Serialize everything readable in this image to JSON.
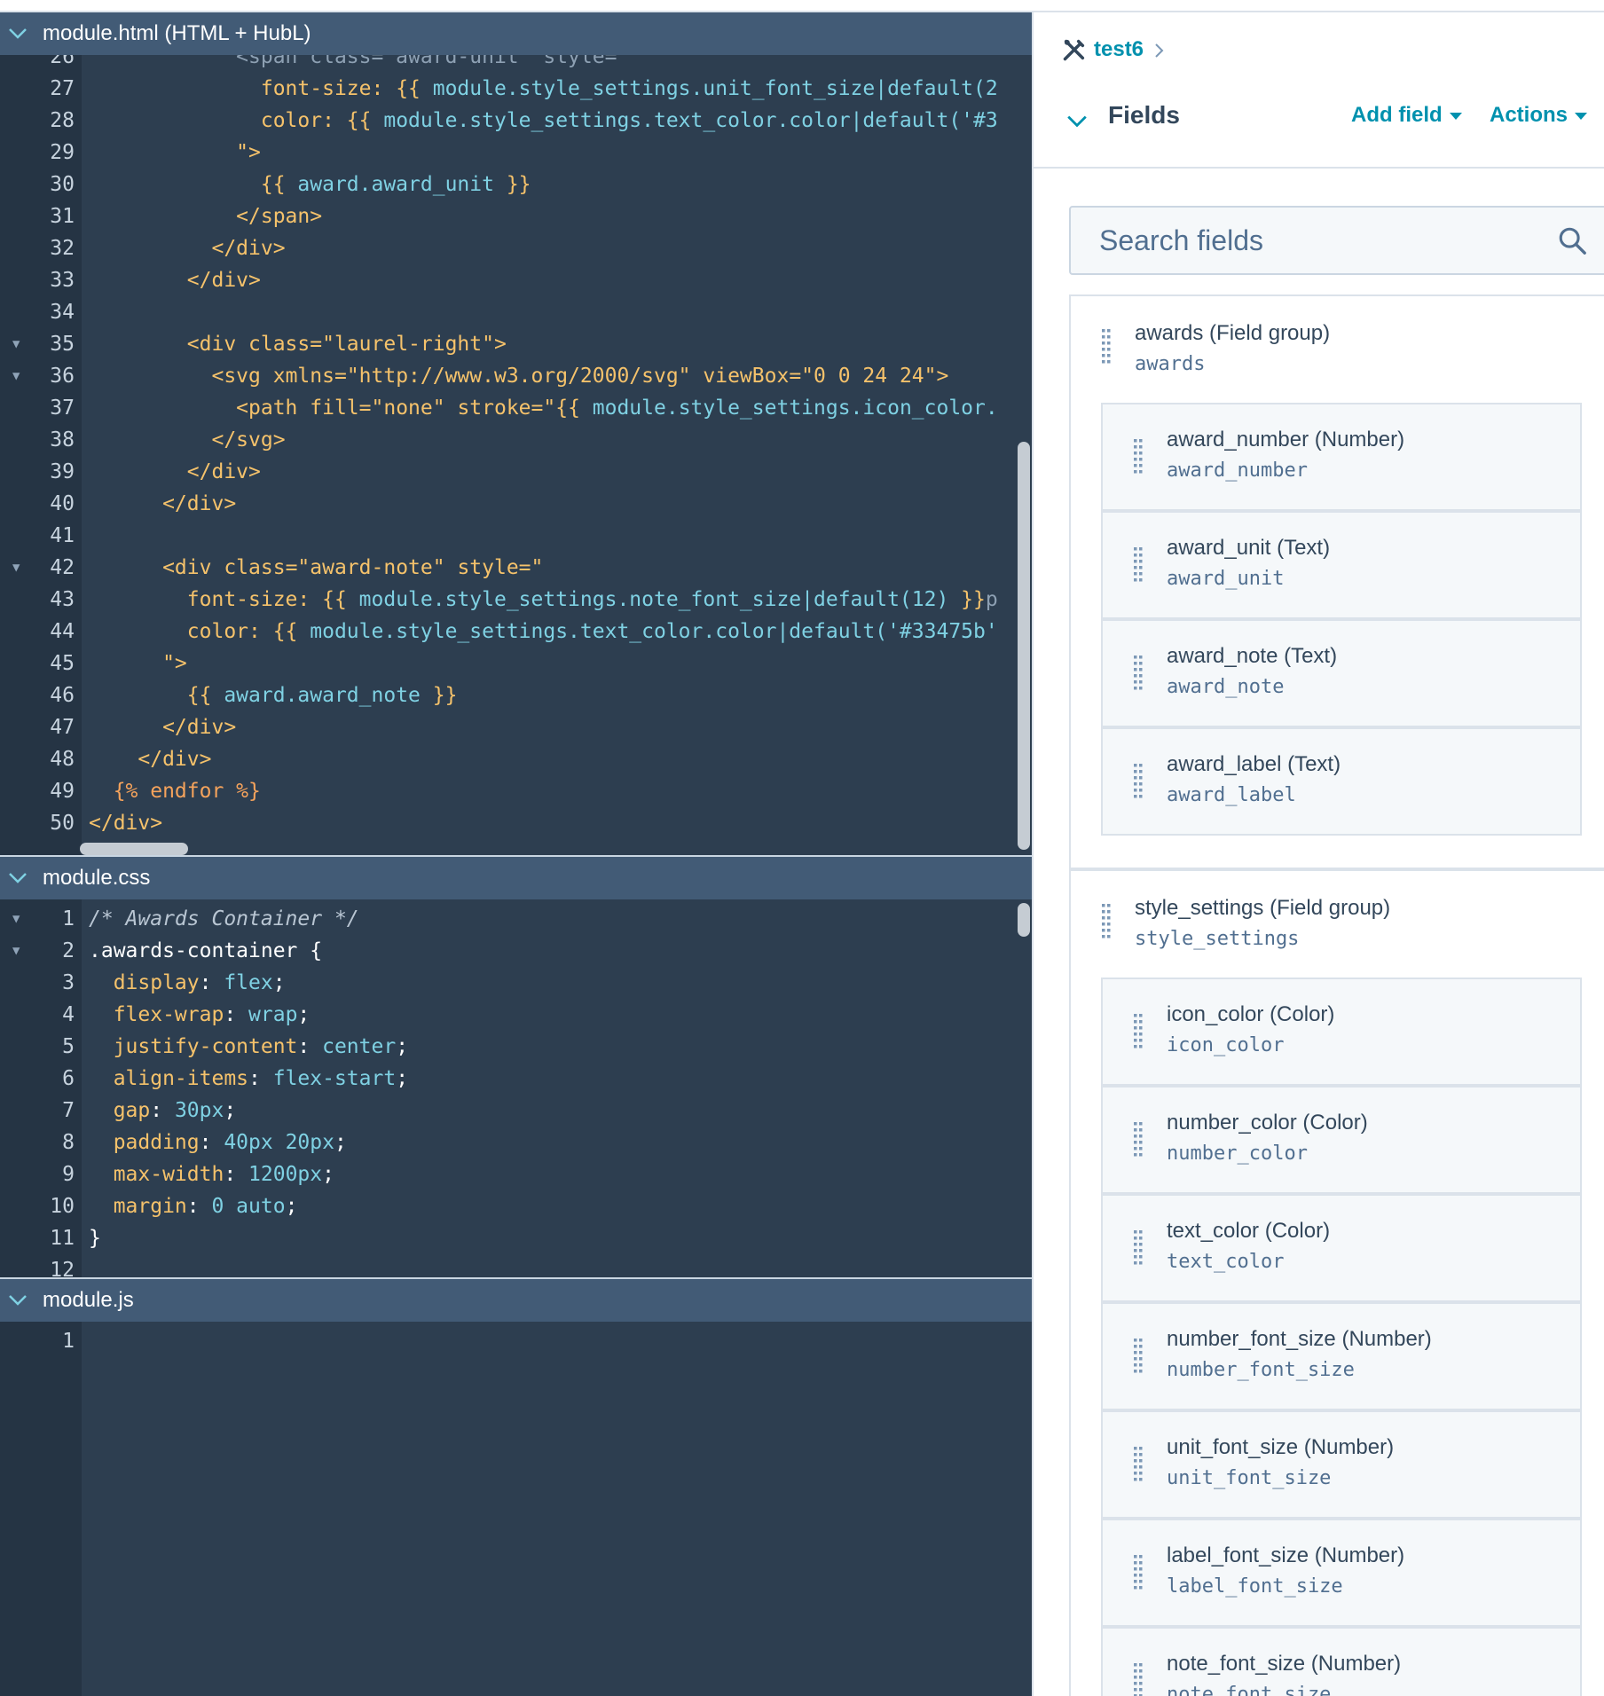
{
  "editor": {
    "html_pane": {
      "title": "module.html (HTML + HubL)",
      "lines": [
        {
          "n": "26",
          "fold": "",
          "tokens": [
            [
              "t-dim",
              "            <span class=\"award-unit\" style=\""
            ]
          ]
        },
        {
          "n": "27",
          "fold": "",
          "tokens": [
            [
              "t-prop",
              "              font-size: "
            ],
            [
              "t-brace",
              "{{ "
            ],
            [
              "t-hubl",
              "module.style_settings.unit_font_size|default(2"
            ]
          ]
        },
        {
          "n": "28",
          "fold": "",
          "tokens": [
            [
              "t-prop",
              "              color: "
            ],
            [
              "t-brace",
              "{{ "
            ],
            [
              "t-hubl",
              "module.style_settings.text_color.color|default('#3"
            ]
          ]
        },
        {
          "n": "29",
          "fold": "",
          "tokens": [
            [
              "t-str",
              "            \">"
            ]
          ]
        },
        {
          "n": "30",
          "fold": "",
          "tokens": [
            [
              "t-brace",
              "              {{ "
            ],
            [
              "t-hubl",
              "award.award_unit "
            ],
            [
              "t-brace",
              "}}"
            ]
          ]
        },
        {
          "n": "31",
          "fold": "",
          "tokens": [
            [
              "t-tag",
              "            </span>"
            ]
          ]
        },
        {
          "n": "32",
          "fold": "",
          "tokens": [
            [
              "t-tag",
              "          </div>"
            ]
          ]
        },
        {
          "n": "33",
          "fold": "",
          "tokens": [
            [
              "t-tag",
              "        </div>"
            ]
          ]
        },
        {
          "n": "34",
          "fold": "",
          "tokens": [
            [
              "t-plain",
              ""
            ]
          ]
        },
        {
          "n": "35",
          "fold": "▼",
          "tokens": [
            [
              "t-tag",
              "        <div "
            ],
            [
              "t-attr",
              "class="
            ],
            [
              "t-str",
              "\"laurel-right\""
            ],
            [
              "t-tag",
              ">"
            ]
          ]
        },
        {
          "n": "36",
          "fold": "▼",
          "tokens": [
            [
              "t-tag",
              "          <svg "
            ],
            [
              "t-attr",
              "xmlns="
            ],
            [
              "t-str",
              "\"http://www.w3.org/2000/svg\" "
            ],
            [
              "t-attr",
              "viewBox="
            ],
            [
              "t-str",
              "\"0 0 24 24\""
            ],
            [
              "t-tag",
              ">"
            ]
          ]
        },
        {
          "n": "37",
          "fold": "",
          "tokens": [
            [
              "t-tag",
              "            <path "
            ],
            [
              "t-attr",
              "fill="
            ],
            [
              "t-str",
              "\"none\" "
            ],
            [
              "t-attr",
              "stroke="
            ],
            [
              "t-str",
              "\"{{ "
            ],
            [
              "t-hubl",
              "module.style_settings.icon_color."
            ]
          ]
        },
        {
          "n": "38",
          "fold": "",
          "tokens": [
            [
              "t-tag",
              "          </svg>"
            ]
          ]
        },
        {
          "n": "39",
          "fold": "",
          "tokens": [
            [
              "t-tag",
              "        </div>"
            ]
          ]
        },
        {
          "n": "40",
          "fold": "",
          "tokens": [
            [
              "t-tag",
              "      </div>"
            ]
          ]
        },
        {
          "n": "41",
          "fold": "",
          "tokens": [
            [
              "t-plain",
              ""
            ]
          ]
        },
        {
          "n": "42",
          "fold": "▼",
          "tokens": [
            [
              "t-tag",
              "      <div "
            ],
            [
              "t-attr",
              "class="
            ],
            [
              "t-str",
              "\"award-note\" "
            ],
            [
              "t-attr",
              "style="
            ],
            [
              "t-str",
              "\""
            ]
          ]
        },
        {
          "n": "43",
          "fold": "",
          "tokens": [
            [
              "t-prop",
              "        font-size: "
            ],
            [
              "t-brace",
              "{{ "
            ],
            [
              "t-hubl",
              "module.style_settings.note_font_size|default(12) "
            ],
            [
              "t-brace",
              "}}"
            ],
            [
              "t-dim",
              "p"
            ]
          ]
        },
        {
          "n": "44",
          "fold": "",
          "tokens": [
            [
              "t-prop",
              "        color: "
            ],
            [
              "t-brace",
              "{{ "
            ],
            [
              "t-hubl",
              "module.style_settings.text_color.color|default('#33475b'"
            ]
          ]
        },
        {
          "n": "45",
          "fold": "",
          "tokens": [
            [
              "t-str",
              "      \">"
            ]
          ]
        },
        {
          "n": "46",
          "fold": "",
          "tokens": [
            [
              "t-brace",
              "        {{ "
            ],
            [
              "t-hubl",
              "award.award_note "
            ],
            [
              "t-brace",
              "}}"
            ]
          ]
        },
        {
          "n": "47",
          "fold": "",
          "tokens": [
            [
              "t-tag",
              "      </div>"
            ]
          ]
        },
        {
          "n": "48",
          "fold": "",
          "tokens": [
            [
              "t-tag",
              "    </div>"
            ]
          ]
        },
        {
          "n": "49",
          "fold": "",
          "tokens": [
            [
              "t-kw",
              "  {% endfor %}"
            ]
          ]
        },
        {
          "n": "50",
          "fold": "",
          "tokens": [
            [
              "t-tag",
              "</div>"
            ]
          ]
        }
      ]
    },
    "css_pane": {
      "title": "module.css",
      "lines": [
        {
          "n": "1",
          "fold": "▼",
          "tokens": [
            [
              "t-cmt",
              "/* Awards Container */"
            ]
          ]
        },
        {
          "n": "2",
          "fold": "▼",
          "tokens": [
            [
              "t-sel",
              ".awards-container {"
            ]
          ]
        },
        {
          "n": "3",
          "fold": "",
          "tokens": [
            [
              "t-prop",
              "  display"
            ],
            [
              "t-plain",
              ": "
            ],
            [
              "t-val",
              "flex"
            ],
            [
              "t-plain",
              ";"
            ]
          ]
        },
        {
          "n": "4",
          "fold": "",
          "tokens": [
            [
              "t-prop",
              "  flex-wrap"
            ],
            [
              "t-plain",
              ": "
            ],
            [
              "t-val",
              "wrap"
            ],
            [
              "t-plain",
              ";"
            ]
          ]
        },
        {
          "n": "5",
          "fold": "",
          "tokens": [
            [
              "t-prop",
              "  justify-content"
            ],
            [
              "t-plain",
              ": "
            ],
            [
              "t-val",
              "center"
            ],
            [
              "t-plain",
              ";"
            ]
          ]
        },
        {
          "n": "6",
          "fold": "",
          "tokens": [
            [
              "t-prop",
              "  align-items"
            ],
            [
              "t-plain",
              ": "
            ],
            [
              "t-val",
              "flex-start"
            ],
            [
              "t-plain",
              ";"
            ]
          ]
        },
        {
          "n": "7",
          "fold": "",
          "tokens": [
            [
              "t-prop",
              "  gap"
            ],
            [
              "t-plain",
              ": "
            ],
            [
              "t-val",
              "30px"
            ],
            [
              "t-plain",
              ";"
            ]
          ]
        },
        {
          "n": "8",
          "fold": "",
          "tokens": [
            [
              "t-prop",
              "  padding"
            ],
            [
              "t-plain",
              ": "
            ],
            [
              "t-val",
              "40px 20px"
            ],
            [
              "t-plain",
              ";"
            ]
          ]
        },
        {
          "n": "9",
          "fold": "",
          "tokens": [
            [
              "t-prop",
              "  max-width"
            ],
            [
              "t-plain",
              ": "
            ],
            [
              "t-val",
              "1200px"
            ],
            [
              "t-plain",
              ";"
            ]
          ]
        },
        {
          "n": "10",
          "fold": "",
          "tokens": [
            [
              "t-prop",
              "  margin"
            ],
            [
              "t-plain",
              ": "
            ],
            [
              "t-val",
              "0 auto"
            ],
            [
              "t-plain",
              ";"
            ]
          ]
        },
        {
          "n": "11",
          "fold": "",
          "tokens": [
            [
              "t-sel",
              "}"
            ]
          ]
        },
        {
          "n": "12",
          "fold": "",
          "tokens": [
            [
              "t-plain",
              ""
            ]
          ]
        }
      ]
    },
    "js_pane": {
      "title": "module.js",
      "lines": [
        {
          "n": "1",
          "fold": "",
          "tokens": [
            [
              "t-plain",
              ""
            ]
          ]
        }
      ]
    }
  },
  "sidebar": {
    "breadcrumb": "test6",
    "title": "Fields",
    "add_field": "Add field",
    "actions": "Actions",
    "search_placeholder": "Search fields",
    "groups": [
      {
        "title": "awards (Field group)",
        "name": "awards",
        "fields": [
          {
            "title": "award_number (Number)",
            "name": "award_number"
          },
          {
            "title": "award_unit (Text)",
            "name": "award_unit"
          },
          {
            "title": "award_note (Text)",
            "name": "award_note"
          },
          {
            "title": "award_label (Text)",
            "name": "award_label"
          }
        ]
      },
      {
        "title": "style_settings (Field group)",
        "name": "style_settings",
        "fields": [
          {
            "title": "icon_color (Color)",
            "name": "icon_color"
          },
          {
            "title": "number_color (Color)",
            "name": "number_color"
          },
          {
            "title": "text_color (Color)",
            "name": "text_color"
          },
          {
            "title": "number_font_size (Number)",
            "name": "number_font_size"
          },
          {
            "title": "unit_font_size (Number)",
            "name": "unit_font_size"
          },
          {
            "title": "label_font_size (Number)",
            "name": "label_font_size"
          },
          {
            "title": "note_font_size (Number)",
            "name": "note_font_size"
          }
        ]
      }
    ]
  },
  "colors": {
    "editor_bg": "#2d3e50",
    "pane_header": "#425b76",
    "accent": "#0091ae"
  }
}
